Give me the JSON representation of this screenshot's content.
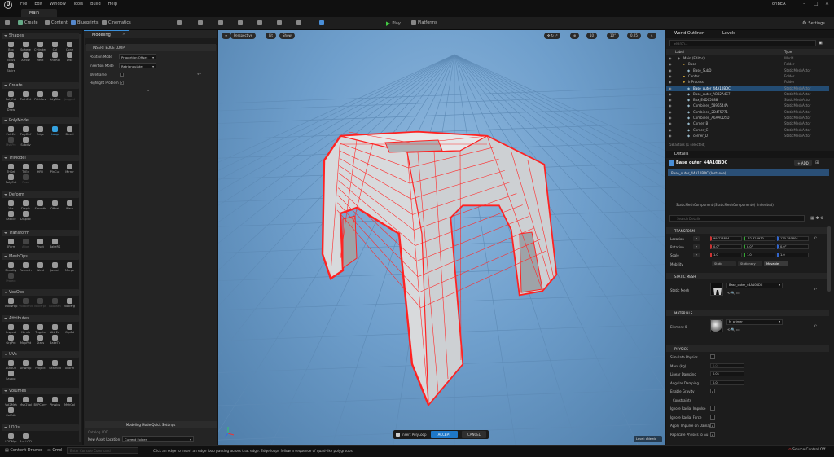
{
  "app": {
    "project_name": "oriBEA",
    "menu": [
      "File",
      "Edit",
      "Window",
      "Tools",
      "Build",
      "Help"
    ],
    "main_tab": "Main"
  },
  "toolbar": {
    "create": "Create",
    "content": "Content",
    "blueprints": "Blueprints",
    "cinematics": "Cinematics",
    "play": "Play",
    "platforms": "Platforms",
    "settings": "Settings"
  },
  "tools_panel": {
    "sections": [
      {
        "title": "Shapes",
        "tools": [
          "Box",
          "Sphere",
          "Cylinder",
          "Cyl",
          "Cone",
          "Torus",
          "Arrow",
          "Rect",
          "RndRct",
          "Disc",
          "Stairs"
        ]
      },
      {
        "title": "Create",
        "tools": [
          "PolyExt",
          "PathExt",
          "PathRev",
          "RdyShp",
          "Jagged",
          "Draw"
        ]
      },
      {
        "title": "PolyModel",
        "tools": [
          "PolyEd",
          "PolyDef",
          "Edge",
          "Loop",
          "Bevel",
          "MshPrc",
          "Subdiv"
        ]
      },
      {
        "title": "TriModel",
        "tools": [
          "TriSel",
          "TriEd",
          "HFill",
          "PlnCut",
          "Mirror",
          "PolyCut",
          "Fuse"
        ]
      },
      {
        "title": "Deform",
        "tools": [
          "Vtx",
          "Displc",
          "Smooth",
          "Offset",
          "Warp",
          "Lattice",
          "Displac"
        ]
      },
      {
        "title": "Transform",
        "tools": [
          "XForm",
          "Align",
          "Pivot",
          "BakeRS"
        ]
      },
      {
        "title": "MeshOps",
        "tools": [
          "Simplify",
          "Remesh",
          "Weld",
          "Jacket",
          "Merge",
          "Project"
        ]
      },
      {
        "title": "VoxOps",
        "tools": [
          "VoxWrap",
          "VoxBlend",
          "VoxMrph",
          "Boolean",
          "VoxMrg"
        ]
      },
      {
        "title": "Attributes",
        "tools": [
          "Inspect",
          "Nrmls",
          "Tngnts",
          "AttrEd",
          "GrpEd",
          "GrpPnt",
          "MapPnt",
          "Stats",
          "BakeTx"
        ]
      },
      {
        "title": "UVs",
        "tools": [
          "AutoUV",
          "Unwrap",
          "Project",
          "SeamEd",
          "XForm",
          "Layout"
        ]
      },
      {
        "title": "Volumes",
        "tools": [
          "Vol2Msh",
          "Msh2Vol",
          "BSPConv",
          "Physics",
          "MshCol",
          "ColEdit"
        ]
      },
      {
        "title": "LODs",
        "tools": [
          "LODMgr",
          "Aut LOD"
        ]
      }
    ],
    "active_tool": "Loop"
  },
  "modeling_panel": {
    "tab": "Modeling",
    "section": "INSERT EDGE LOOP",
    "props": [
      {
        "label": "Position Mode",
        "value": "Proportion Offset"
      },
      {
        "label": "Insertion Mode",
        "value": "Retriangulate"
      },
      {
        "label": "Wireframe",
        "checked": false
      },
      {
        "label": "Highlight Problem",
        "checked": true
      }
    ],
    "quick_settings_title": "Modeling Mode Quick Settings",
    "catalog_lod": "Catalog LOD",
    "new_asset_location_label": "New Asset Location",
    "new_asset_location_value": "Current Folder"
  },
  "viewport": {
    "view_mode": "Perspective",
    "lit": "Lit",
    "show": "Show",
    "snap_values": [
      "10",
      "10°",
      "0.25"
    ],
    "camera_speed": "4",
    "level_badge": "Level: oNewla",
    "accept_bar": {
      "label": "Insert PolyLoop",
      "accept": "ACCEPT",
      "cancel": "CANCEL"
    }
  },
  "outliner": {
    "tabs": [
      "World Outliner",
      "Levels"
    ],
    "search_placeholder": "Search...",
    "columns": [
      "Label",
      "Type"
    ],
    "rows": [
      {
        "label": "Main (Editor)",
        "type": "World",
        "indent": 0
      },
      {
        "label": "Base",
        "type": "Folder",
        "indent": 1
      },
      {
        "label": "Base_SubD",
        "type": "StaticMeshActor",
        "indent": 2
      },
      {
        "label": "Center",
        "type": "Folder",
        "indent": 1
      },
      {
        "label": "InProcess",
        "type": "Folder",
        "indent": 1
      },
      {
        "label": "Base_outer_44A10BDC",
        "type": "StaticMeshActor",
        "indent": 2,
        "selected": true
      },
      {
        "label": "Base_outer_AB82A4C7",
        "type": "StaticMeshActor",
        "indent": 2
      },
      {
        "label": "Box_E4D05688",
        "type": "StaticMeshActor",
        "indent": 2
      },
      {
        "label": "Combined_5896544A",
        "type": "StaticMeshActor",
        "indent": 2
      },
      {
        "label": "Combined_2D4F5771",
        "type": "StaticMeshActor",
        "indent": 2
      },
      {
        "label": "Combined_A6AA0D5D",
        "type": "StaticMeshActor",
        "indent": 2
      },
      {
        "label": "Corner_B",
        "type": "StaticMeshActor",
        "indent": 2
      },
      {
        "label": "Corner_C",
        "type": "StaticMeshActor",
        "indent": 2
      },
      {
        "label": "corner_D",
        "type": "StaticMeshActor",
        "indent": 2
      }
    ],
    "footer": "58 actors (1 selected)"
  },
  "details": {
    "tab": "Details",
    "selected_name": "Base_outer_44A10BDC",
    "add_label": "+ ADD",
    "instance_row": "Base_outer_44A10BDC (Instance)",
    "component_row": "StaticMeshComponent (StaticMeshComponent0) (Inherited)",
    "search_placeholder": "Search Details",
    "transform": {
      "title": "TRANSFORM",
      "location_label": "Location",
      "location": [
        "99.718844",
        "-62.323970",
        "120.380804"
      ],
      "rotation_label": "Rotation",
      "rotation": [
        "0.0°",
        "0.0°",
        "0.0°"
      ],
      "scale_label": "Scale",
      "scale": [
        "1.0",
        "1.0",
        "1.0"
      ],
      "mobility_label": "Mobility",
      "mobility_options": [
        "Static",
        "Stationary",
        "Movable"
      ],
      "mobility_selected": "Movable"
    },
    "static_mesh": {
      "title": "STATIC MESH",
      "label": "Static Mesh",
      "value": "Base_outer_44A10BDC"
    },
    "materials": {
      "title": "MATERIALS",
      "label": "Element 0",
      "value": "M_primer"
    },
    "physics": {
      "title": "PHYSICS",
      "rows": [
        {
          "label": "Simulate Physics",
          "kind": "checkbox",
          "checked": false
        },
        {
          "label": "Mass (kg)",
          "kind": "value",
          "value": "0.0"
        },
        {
          "label": "Linear Damping",
          "kind": "value",
          "value": "0.01"
        },
        {
          "label": "Angular Damping",
          "kind": "value",
          "value": "0.0"
        },
        {
          "label": "Enable Gravity",
          "kind": "checkbox",
          "checked": true
        },
        {
          "label": "Constraints",
          "kind": "group"
        },
        {
          "label": "Ignore Radial Impulse",
          "kind": "checkbox",
          "checked": false
        },
        {
          "label": "Ignore Radial Force",
          "kind": "checkbox",
          "checked": false
        },
        {
          "label": "Apply Impulse on Damage",
          "kind": "checkbox",
          "checked": true
        },
        {
          "label": "Replicate Physics to Au",
          "kind": "checkbox",
          "checked": true
        }
      ]
    }
  },
  "statusbar": {
    "content_drawer": "Content Drawer",
    "cmd": "Cmd",
    "cmd_placeholder": "Enter Console Command",
    "message": "Click an edge to insert an edge loop passing across that edge. Edge loops follow a sequence of quad-like polygroups.",
    "source_control": "Source Control Off"
  },
  "colors": {
    "accent": "#1e78c8",
    "selection": "#234c73",
    "wire": "#ff2222",
    "viewport_sky": "#7aa8d4"
  }
}
